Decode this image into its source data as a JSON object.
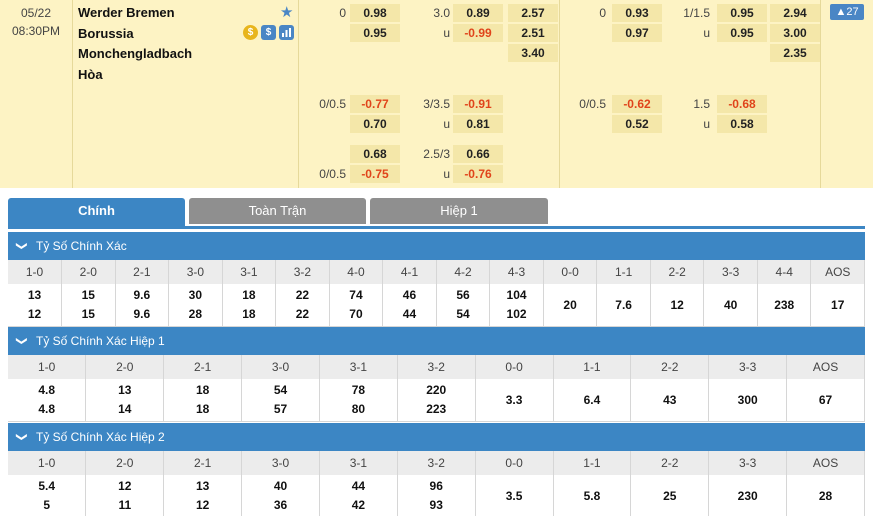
{
  "match": {
    "date": "05/22",
    "time": "08:30PM",
    "home": "Werder Bremen",
    "away_line1": "Borussia",
    "away_line2": "Monchengladbach",
    "draw": "Hòa"
  },
  "odds": {
    "r1": {
      "hcap": "0",
      "h1": "0.98",
      "ou": "3.0",
      "o1": "0.89",
      "x1": "2.57",
      "hcap2": "0",
      "h2": "0.93",
      "ou2": "1/1.5",
      "o2": "0.95",
      "x2": "2.94"
    },
    "r2": {
      "h1": "0.95",
      "ou": "u",
      "o1": "-0.99",
      "x1": "2.51",
      "h2": "0.97",
      "ou2": "u",
      "o2": "0.95",
      "x2": "3.00"
    },
    "r3": {
      "x1": "3.40",
      "x2": "2.35"
    },
    "r4": {
      "hcap": "0/0.5",
      "h1": "-0.77",
      "ou": "3/3.5",
      "o1": "-0.91",
      "hcap2": "0/0.5",
      "h2": "-0.62",
      "ou2": "1.5",
      "o2": "-0.68"
    },
    "r5": {
      "h1": "0.70",
      "ou": "u",
      "o1": "0.81",
      "h2": "0.52",
      "ou2": "u",
      "o2": "0.58"
    },
    "r6": {
      "h1": "0.68",
      "ou": "2.5/3",
      "o1": "0.66"
    },
    "r7": {
      "hcap": "0/0.5",
      "h1": "-0.75",
      "ou": "u",
      "o1": "-0.76"
    },
    "more": "▲27"
  },
  "icons": {
    "coin": "$",
    "dollar": "$",
    "stats": "▮"
  },
  "tabs": [
    "Chính",
    "Toàn Trận",
    "Hiệp 1"
  ],
  "sections": [
    {
      "title": "Tỷ Số Chính Xác",
      "headers": [
        "1-0",
        "2-0",
        "2-1",
        "3-0",
        "3-1",
        "3-2",
        "4-0",
        "4-1",
        "4-2",
        "4-3",
        "0-0",
        "1-1",
        "2-2",
        "3-3",
        "4-4",
        "AOS"
      ],
      "cells": [
        [
          "13",
          "12"
        ],
        [
          "15",
          "15"
        ],
        [
          "9.6",
          "9.6"
        ],
        [
          "30",
          "28"
        ],
        [
          "18",
          "18"
        ],
        [
          "22",
          "22"
        ],
        [
          "74",
          "70"
        ],
        [
          "46",
          "44"
        ],
        [
          "56",
          "54"
        ],
        [
          "104",
          "102"
        ],
        [
          "20"
        ],
        [
          "7.6"
        ],
        [
          "12"
        ],
        [
          "40"
        ],
        [
          "238"
        ],
        [
          "17"
        ]
      ]
    },
    {
      "title": "Tỷ Số Chính Xác Hiệp 1",
      "headers": [
        "1-0",
        "2-0",
        "2-1",
        "3-0",
        "3-1",
        "3-2",
        "0-0",
        "1-1",
        "2-2",
        "3-3",
        "AOS"
      ],
      "cells": [
        [
          "4.8",
          "4.8"
        ],
        [
          "13",
          "14"
        ],
        [
          "18",
          "18"
        ],
        [
          "54",
          "57"
        ],
        [
          "78",
          "80"
        ],
        [
          "220",
          "223"
        ],
        [
          "3.3"
        ],
        [
          "6.4"
        ],
        [
          "43"
        ],
        [
          "300"
        ],
        [
          "67"
        ]
      ]
    },
    {
      "title": "Tỷ Số Chính Xác Hiệp 2",
      "headers": [
        "1-0",
        "2-0",
        "2-1",
        "3-0",
        "3-1",
        "3-2",
        "0-0",
        "1-1",
        "2-2",
        "3-3",
        "AOS"
      ],
      "cells": [
        [
          "5.4",
          "5"
        ],
        [
          "12",
          "11"
        ],
        [
          "13",
          "12"
        ],
        [
          "40",
          "36"
        ],
        [
          "44",
          "42"
        ],
        [
          "96",
          "93"
        ],
        [
          "3.5"
        ],
        [
          "5.8"
        ],
        [
          "25"
        ],
        [
          "230"
        ],
        [
          "28"
        ]
      ]
    }
  ],
  "colors": {
    "panel": "#fdf3c4",
    "odd_bg": "#f4e7a9",
    "negative": "#e0441b",
    "accent": "#3c86c4",
    "tab_inactive": "#8f8f8f"
  }
}
